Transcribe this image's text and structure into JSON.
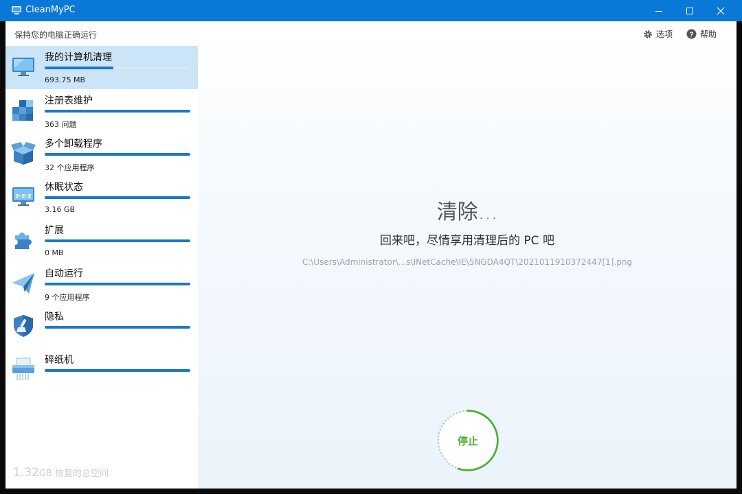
{
  "window": {
    "title": "CleanMyPC"
  },
  "header": {
    "tagline": "保持您的电脑正确运行",
    "options_label": "选项",
    "help_label": "帮助"
  },
  "sidebar": {
    "items": [
      {
        "label": "我的计算机清理",
        "sub": "693.75 MB",
        "progress": 0.47,
        "icon": "monitor-icon",
        "active": true
      },
      {
        "label": "注册表维护",
        "sub": "363 问题",
        "progress": 1.0,
        "icon": "registry-cubes-icon"
      },
      {
        "label": "多个卸载程序",
        "sub": "32 个应用程序",
        "progress": 1.0,
        "icon": "open-box-icon"
      },
      {
        "label": "休眠状态",
        "sub": "3.16 GB",
        "progress": 1.0,
        "icon": "sleep-monitor-icon"
      },
      {
        "label": "扩展",
        "sub": "0 MB",
        "progress": 1.0,
        "icon": "puzzle-icon"
      },
      {
        "label": "自动运行",
        "sub": "9 个应用程序",
        "progress": 1.0,
        "icon": "paper-plane-icon"
      },
      {
        "label": "隐私",
        "sub": "",
        "progress": 1.0,
        "icon": "shield-brush-icon"
      },
      {
        "label": "碎纸机",
        "sub": "",
        "progress": 1.0,
        "icon": "shredder-icon"
      }
    ],
    "total_number": "1.32",
    "total_unit": "GB",
    "total_label": " 恢复的总空间"
  },
  "main": {
    "title": "清除...",
    "subtitle": "回来吧，尽情享用清理后的 PC 吧",
    "current_path": "C:\\Users\\Administrator\\...s\\INetCache\\IE\\5NGDA4QT\\2021011910372447[1].png",
    "stop_label": "停止",
    "progress": 0.55
  },
  "colors": {
    "titlebar": "#0a78d7",
    "active_item": "#cce4f7",
    "progress_fill": "#1a78cc",
    "stop_green": "#4caf2e"
  }
}
